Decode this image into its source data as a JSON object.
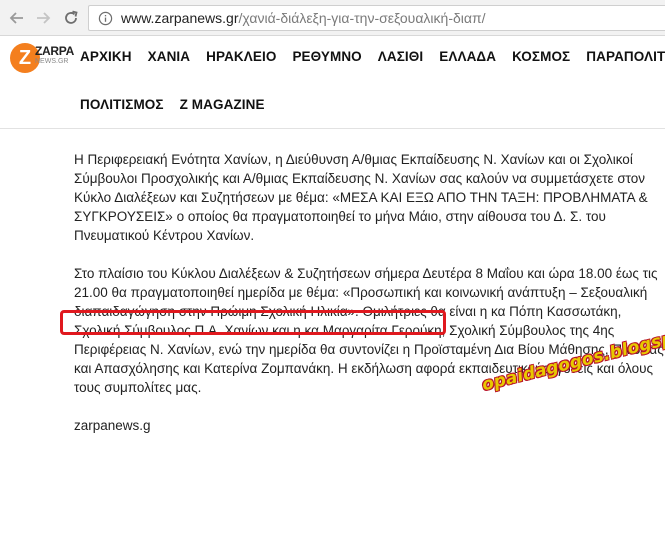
{
  "browser": {
    "url_domain": "www.zarpanews.gr",
    "url_path": "/χανιά-διάλεξη-για-την-σεξουαλική-διαπ/"
  },
  "logo": {
    "letter": "Z",
    "word": "ZARPA",
    "sub": "NEWS.GR"
  },
  "menu": {
    "row1": [
      "ΑΡΧΙΚΗ",
      "ΧΑΝΙΑ",
      "ΗΡΑΚΛΕΙΟ",
      "ΡΕΘΥΜΝΟ",
      "ΛΑΣΙΘΙ",
      "ΕΛΛΑΔΑ",
      "ΚΟΣΜΟΣ",
      "ΠΑΡΑΠΟΛΙΤ"
    ],
    "row2": [
      "ΠΟΛΙΤΙΣΜΟΣ",
      "Z MAGAZINE"
    ]
  },
  "article": {
    "p1": "Η Περιφερειακή Ενότητα Χανίων, η Διεύθυνση Α/θμιας Εκπαίδευσης Ν. Χανίων και οι Σχολικοί Σύμβουλοι Προσχολικής και Α/θμιας Εκπαίδευσης Ν. Χανίων σας καλούν να συμμετάσχετε στον Κύκλο Διαλέξεων και Συζητήσεων με θέμα: «ΜΕΣΑ ΚΑΙ ΕΞΩ ΑΠΟ ΤΗΝ ΤΑΞΗ: ΠΡΟΒΛΗΜΑΤΑ & ΣΥΓΚΡΟΥΣΕΙΣ» ο οποίος θα πραγματοποιηθεί το μήνα Μάιο, στην αίθουσα του Δ. Σ. του Πνευματικού Κέντρου Χανίων.",
    "p2": "Στο πλαίσιο του Κύκλου Διαλέξεων & Συζητήσεων σήμερα  Δευτέρα 8 Μαΐου και ώρα 18.00 έως τις 21.00 θα πραγματοποιηθεί ημερίδα με θέμα: «Προσωπική και κοινωνική ανάπτυξη – Σεξουαλική διαπαιδαγώγηση στην Πρώιμη Σχολική Ηλικία». Ομιλήτριες θα είναι η κα Πόπη Κασσωτάκη, Σχολική Σύμβουλος Π.Α. Χανίων και η κα Μαργαρίτα Γερούκη, Σχολική Σύμβουλος της 4ης Περιφέρειας Ν. Χανίων, ενώ την ημερίδα θα συντονίζει η Προϊσταμένη Δια Βίου Μάθησης, Παιδείας και Απασχόλησης και Κατερίνα Ζομπανάκη. Η εκδήλωση αφορά εκπαιδευτικούς, γονείς και όλους τους συμπολίτες μας.",
    "source": "zarpanews.g"
  },
  "watermark": "opaidagogos.blogspot.com",
  "colors": {
    "logo_orange": "#f47f1e",
    "highlight_red": "#e0181e",
    "watermark_yellow": "#e8c800"
  }
}
